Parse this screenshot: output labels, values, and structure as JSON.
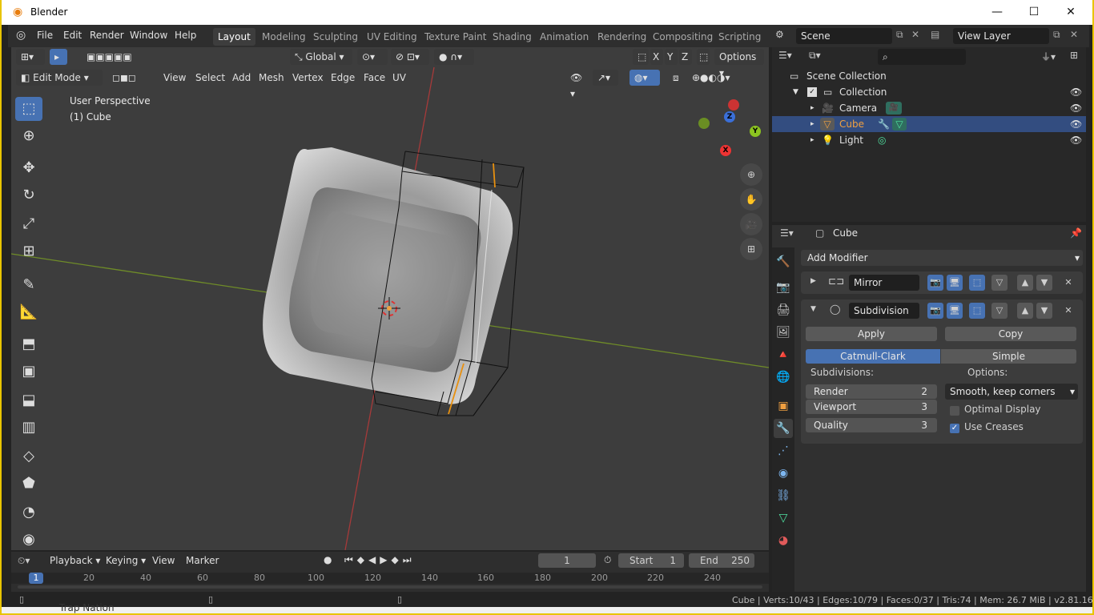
{
  "window": {
    "title": "Blender",
    "minimize": "—",
    "maximize": "☐",
    "close": "✕"
  },
  "menus": [
    "File",
    "Edit",
    "Render",
    "Window",
    "Help"
  ],
  "workspaces": [
    "Layout",
    "Modeling",
    "Sculpting",
    "UV Editing",
    "Texture Paint",
    "Shading",
    "Animation",
    "Rendering",
    "Compositing",
    "Scripting"
  ],
  "scene": {
    "name": "Scene",
    "view_layer": "View Layer"
  },
  "viewport": {
    "mode": "Edit Mode",
    "header_menus": [
      "View",
      "Select",
      "Add",
      "Mesh",
      "Vertex",
      "Edge",
      "Face",
      "UV"
    ],
    "orientation": "Global",
    "axes": [
      "X",
      "Y",
      "Z"
    ],
    "options_label": "Options",
    "overlay_title": "User Perspective",
    "overlay_object": "(1) Cube",
    "gizmo": {
      "x": "X",
      "y": "Y",
      "z": "Z"
    }
  },
  "outliner": {
    "root": "Scene Collection",
    "collection": "Collection",
    "items": [
      {
        "name": "Camera",
        "selected": false
      },
      {
        "name": "Cube",
        "selected": true
      },
      {
        "name": "Light",
        "selected": false
      }
    ]
  },
  "properties": {
    "object": "Cube",
    "add_modifier": "Add Modifier",
    "mirror": {
      "name": "Mirror"
    },
    "subdivision": {
      "name": "Subdivision",
      "apply": "Apply",
      "copy": "Copy",
      "algorithms": [
        "Catmull-Clark",
        "Simple"
      ],
      "subdivisions_label": "Subdivisions:",
      "options_label": "Options:",
      "render_label": "Render",
      "render_value": "2",
      "viewport_label": "Viewport",
      "viewport_value": "3",
      "quality_label": "Quality",
      "quality_value": "3",
      "uv_smooth": "Smooth, keep corners",
      "optimal_display": "Optimal Display",
      "optimal_display_checked": false,
      "use_creases": "Use Creases",
      "use_creases_checked": true
    }
  },
  "timeline": {
    "menus": [
      "Playback",
      "Keying",
      "View",
      "Marker"
    ],
    "current_frame": "1",
    "start_label": "Start",
    "start": "1",
    "end_label": "End",
    "end": "250",
    "ticks": [
      "1",
      "20",
      "40",
      "60",
      "80",
      "100",
      "120",
      "140",
      "160",
      "180",
      "200",
      "220",
      "240"
    ]
  },
  "status": {
    "text": "Cube | Verts:10/43 | Edges:10/79 | Faces:0/37 | Tris:74 | Mem: 26.7 MiB | v2.81.16"
  },
  "taskbar": {
    "label": "Trap Nation"
  },
  "colors": {
    "accent": "#4772b3",
    "selected_row": "#334d80",
    "frame_border": "#e8c400",
    "active_object": "#f0a040"
  }
}
